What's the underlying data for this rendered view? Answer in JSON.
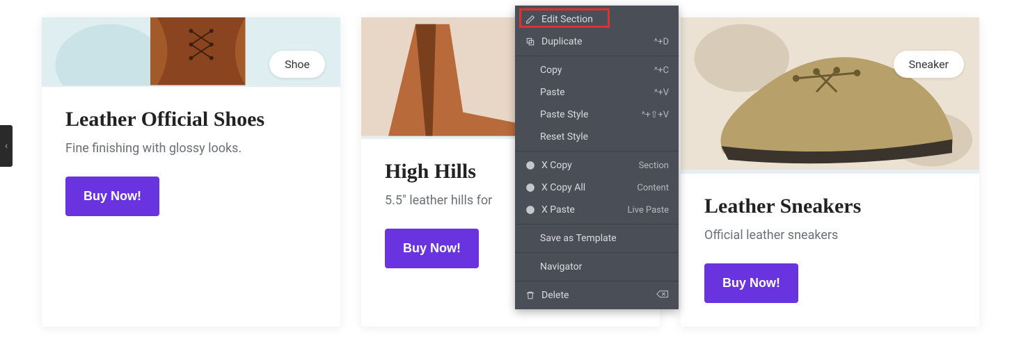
{
  "side_tab_icon": "‹",
  "cards": [
    {
      "badge": "Shoe",
      "title": "Leather Official Shoes",
      "desc": "Fine finishing with glossy looks.",
      "button": "Buy Now!"
    },
    {
      "badge": "",
      "title": "High Hills",
      "desc": "5.5\" leather hills for",
      "button": "Buy Now!"
    },
    {
      "badge": "Sneaker",
      "title": "Leather Sneakers",
      "desc": "Official leather sneakers",
      "button": "Buy Now!"
    }
  ],
  "context_menu": {
    "edit_section": "Edit Section",
    "duplicate": {
      "label": "Duplicate",
      "shortcut": "^+D"
    },
    "copy": {
      "label": "Copy",
      "shortcut": "^+C"
    },
    "paste": {
      "label": "Paste",
      "shortcut": "^+V"
    },
    "paste_style": {
      "label": "Paste Style",
      "shortcut": "^+⇧+V"
    },
    "reset_style": "Reset Style",
    "x_copy": {
      "label": "X Copy",
      "shortcut": "Section"
    },
    "x_copy_all": {
      "label": "X Copy All",
      "shortcut": "Content"
    },
    "x_paste": {
      "label": "X Paste",
      "shortcut": "Live Paste"
    },
    "save_template": "Save as Template",
    "navigator": "Navigator",
    "delete": "Delete"
  }
}
